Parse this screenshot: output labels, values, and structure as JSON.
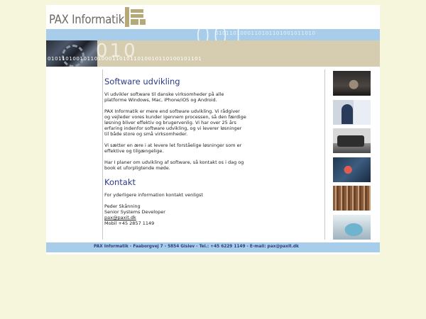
{
  "header": {
    "brand": "PAX Informatik",
    "band_bits": "0101101000110101101001011010",
    "band_digits": "001",
    "tan_bits": "0101101001011010001101011010010110100101101",
    "tan_digits": "010"
  },
  "sections": [
    {
      "title": "Software udvikling",
      "paragraphs": [
        "Vi udvikler software til danske virksomheder på alle platforme Windows, Mac, iPhone/iOS og Android.",
        "PAX Informatik er mere end software udvikling. Vi rådgiver og vejleder vores kunder igennem processen, så den færdige løsning bliver effektiv og brugervenlig. Vi har over 25 års erfaring indenfor software udvikling, og vi leverer løsninger til både store og små virksomheder.",
        "Vi sætter en ære i at levere let forståelige løsninger som er effektive og tilgængelige.",
        "Har I planer om udvikling af software, så kontakt os i dag og book et uforpligtende møde."
      ]
    }
  ],
  "contact": {
    "title": "Kontakt",
    "intro": "For yderligere information kontakt venligst",
    "name": "Peder Skånning",
    "role": "Senior Systems Developer",
    "email": "pax@paxit.dk",
    "phone": "Mobil +45 2857 1149"
  },
  "photos": [
    "handshake-photo",
    "presenter-photo",
    "laptop-photo",
    "red-light-photo",
    "archive-photo",
    "piggy-bank-photo"
  ],
  "footer": {
    "text": "PAX Informatik - Faaborgvej 7 - 5854 Gislev - Tel.: +45 6229 1149 - E-mail: pax@paxit.dk"
  },
  "colors": {
    "page_bg": "#f6f6dc",
    "band_blue": "#a7cdea",
    "band_tan": "#d6cdb1",
    "heading": "#2c3a8a",
    "logo": "#b6a877"
  }
}
